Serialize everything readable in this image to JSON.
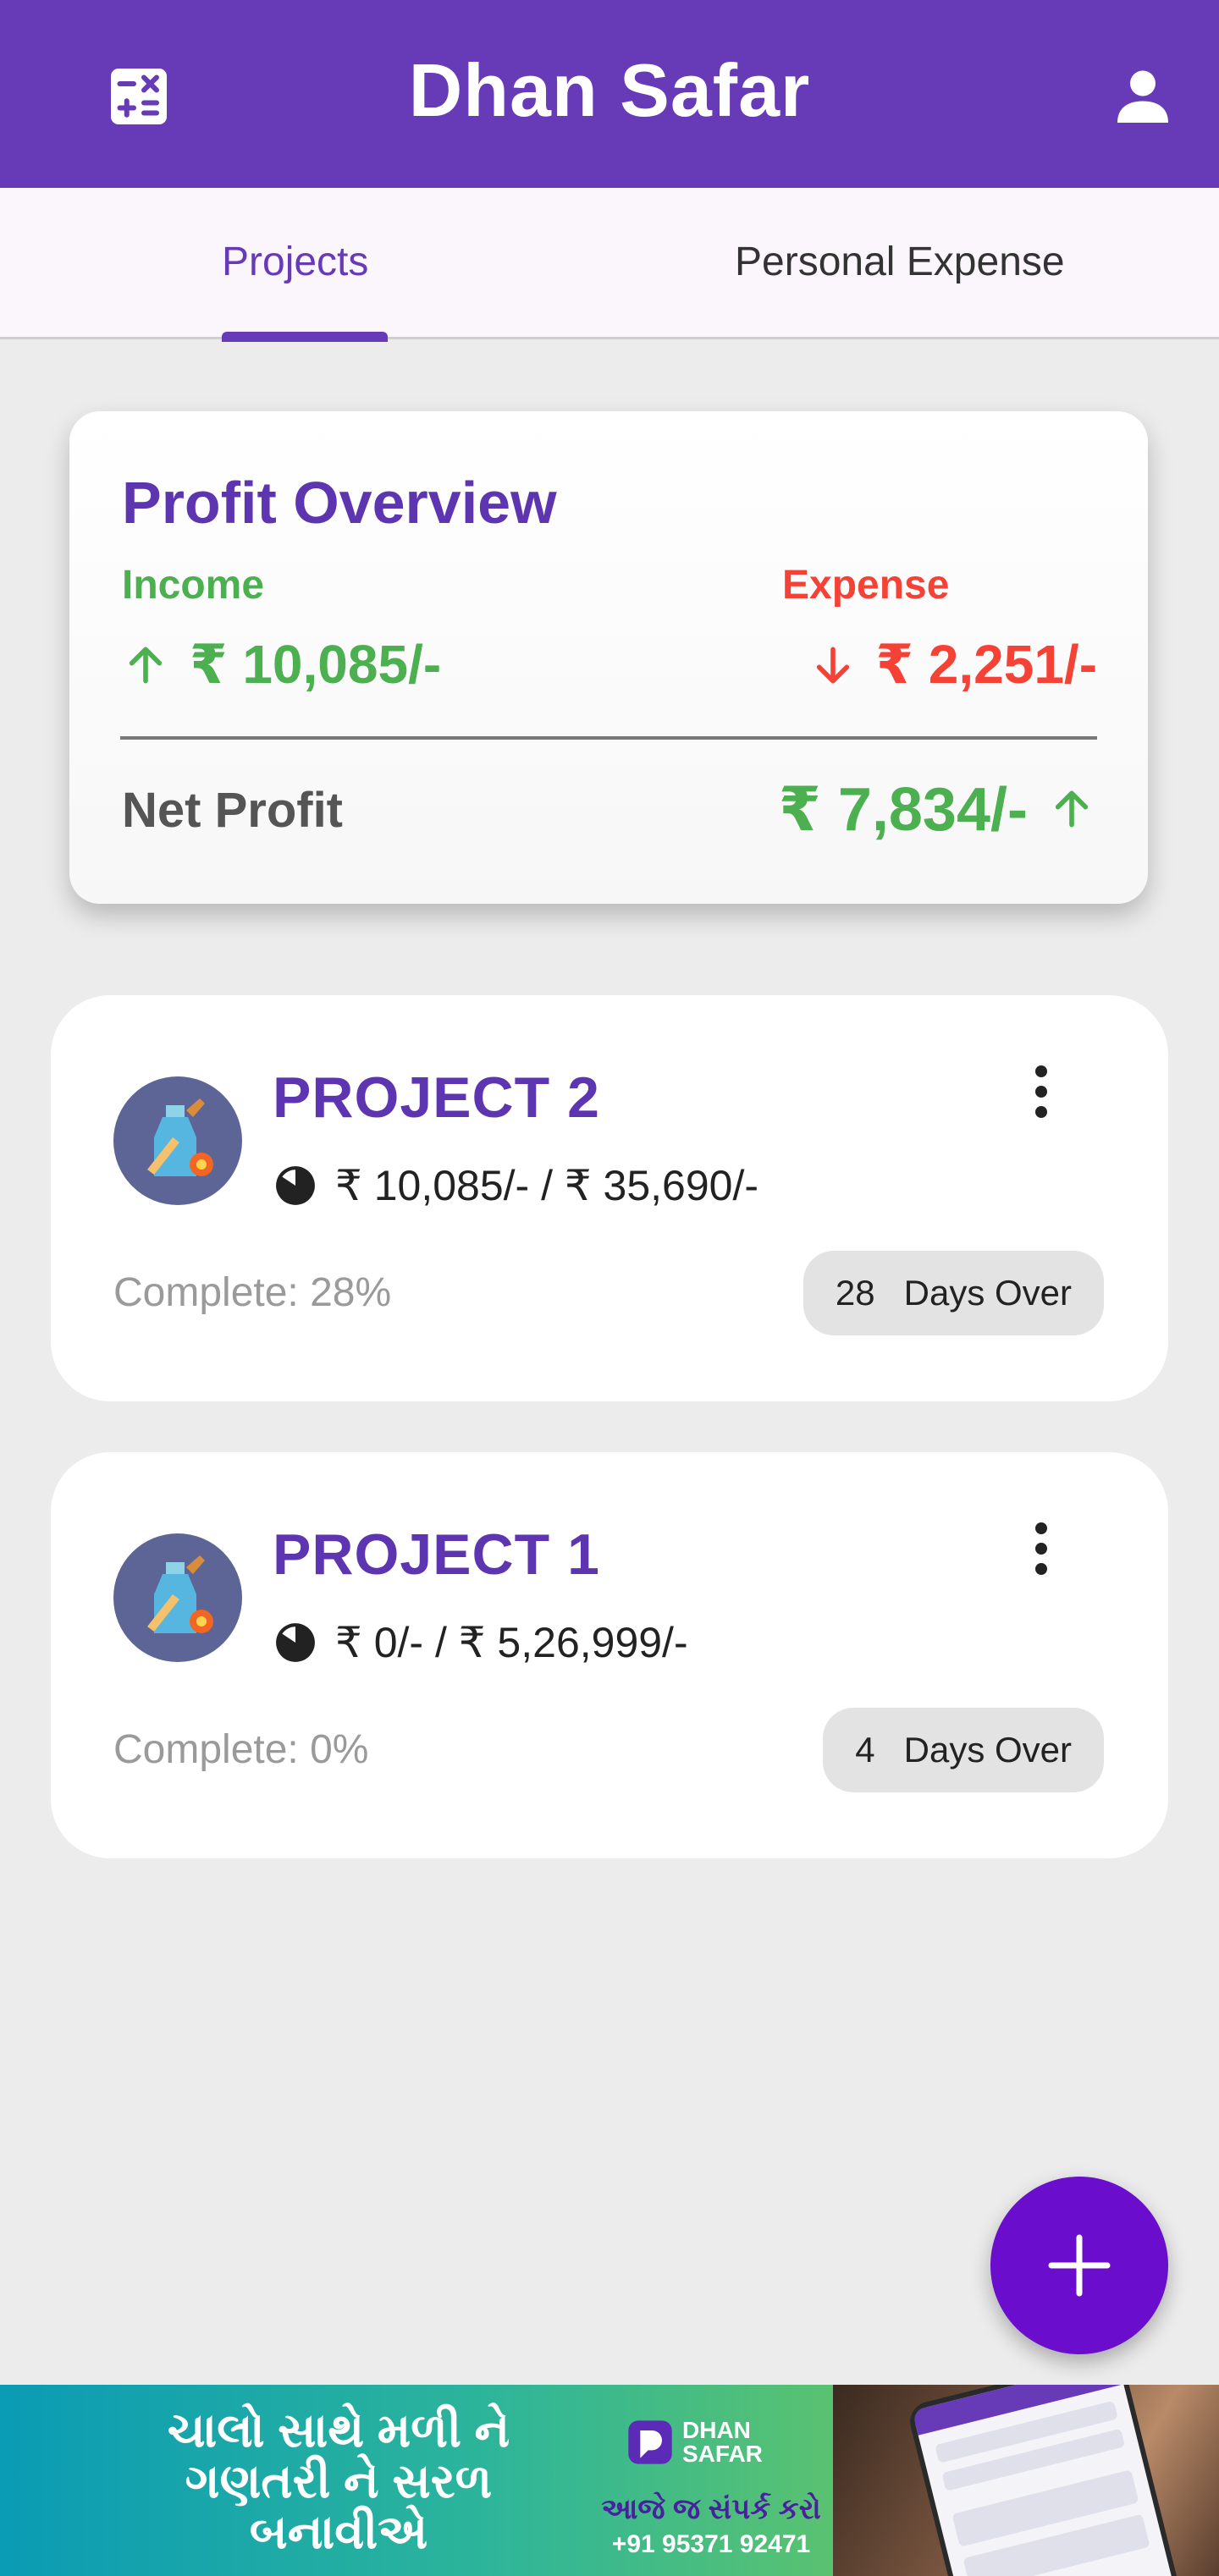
{
  "app": {
    "title": "Dhan Safar"
  },
  "icons": {
    "left": "calculator-icon",
    "right": "profile-icon"
  },
  "colors": {
    "primary": "#673ab7",
    "income": "#4caf50",
    "expense": "#f44336",
    "fab": "#6a0dcc"
  },
  "tabs": [
    {
      "label": "Projects",
      "selected": true
    },
    {
      "label": "Personal Expense",
      "selected": false
    }
  ],
  "overview": {
    "title": "Profit Overview",
    "income_label": "Income",
    "income_value": "₹ 10,085/-",
    "expense_label": "Expense",
    "expense_value": "₹ 2,251/-",
    "net_label": "Net Profit",
    "net_value": "₹ 7,834/-"
  },
  "projects": [
    {
      "name": "PROJECT 2",
      "amounts": "₹ 10,085/- /  ₹ 35,690/-",
      "complete": "Complete: 28%",
      "days_num": "28",
      "days_label": "Days Over"
    },
    {
      "name": "PROJECT 1",
      "amounts": "₹ 0/- /  ₹ 5,26,999/-",
      "complete": "Complete: 0%",
      "days_num": "4",
      "days_label": "Days Over"
    }
  ],
  "fab": {
    "icon": "plus-icon"
  },
  "banner": {
    "text_line1": "ચાલો સાથે મળી ને",
    "text_line2": "ગણતરી ને સરળ",
    "text_line3": "બનાવીએ",
    "brand_line1": "DHAN",
    "brand_line2": "SAFAR",
    "cta": "આજે જ સંપર્ક કરો",
    "phone": "+91 95371 92471"
  }
}
